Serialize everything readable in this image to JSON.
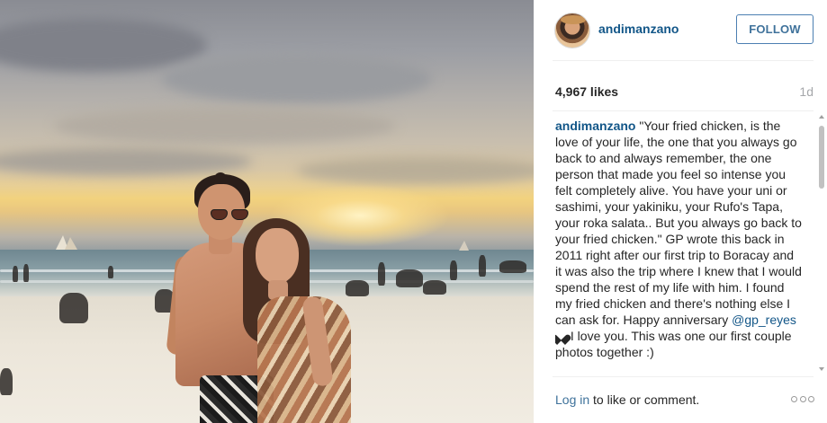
{
  "post": {
    "username": "andimanzano",
    "follow_label": "FOLLOW",
    "likes": "4,967 likes",
    "time_ago": "1d",
    "caption": {
      "username": "andimanzano",
      "text_part1": " \"Your fried chicken, is the love of your life, the one that you always go back to and always remember, the one person that made you feel so intense you felt completely alive. You have your uni or sashimi, your yakiniku, your Rufo's Tapa, your roka salata.. But you always go back to your fried chicken.\" GP wrote this back in 2011 right after our first trip to Boracay and it was also the trip where I knew that I would spend the rest of my life with him. I found my fried chicken and there's nothing else I can ask for. Happy anniversary ",
      "mention": "@gp_reyes",
      "text_part2": " I love you. This was one our first couple photos together :)"
    },
    "footer": {
      "login_link": "Log in",
      "login_rest": " to like or comment."
    }
  },
  "icons": {
    "heart": "heart-icon",
    "more": "more-options-icon",
    "avatar": "avatar"
  },
  "colors": {
    "link_blue": "#125688",
    "follow_blue": "#3f729b",
    "muted": "#a5a7aa"
  }
}
